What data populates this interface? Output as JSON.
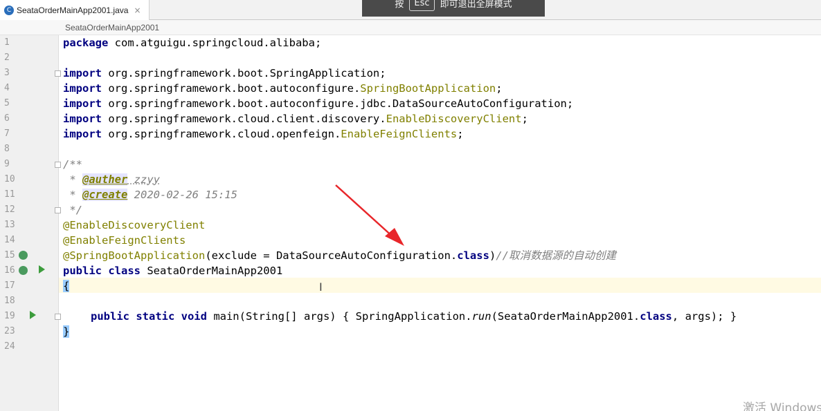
{
  "tab": {
    "filename": "SeataOrderMainApp2001.java",
    "close": "×",
    "icon": "C"
  },
  "overlay": {
    "before": "按",
    "key": "Esc",
    "after": "即可退出全屏模式"
  },
  "breadcrumb": "SeataOrderMainApp2001",
  "line_numbers": [
    "1",
    "2",
    "3",
    "4",
    "5",
    "6",
    "7",
    "8",
    "9",
    "10",
    "11",
    "12",
    "13",
    "14",
    "15",
    "16",
    "17",
    "18",
    "19",
    "23",
    "24"
  ],
  "code": {
    "l1_kw": "package",
    "l1_rest": " com.atguigu.springcloud.alibaba;",
    "imp": "import",
    "l3": " org.springframework.boot.SpringApplication;",
    "l4_a": " org.springframework.boot.autoconfigure.",
    "l4_b": "SpringBootApplication",
    "l4_c": ";",
    "l5": " org.springframework.boot.autoconfigure.jdbc.DataSourceAutoConfiguration;",
    "l6_a": " org.springframework.cloud.client.discovery.",
    "l6_b": "EnableDiscoveryClient",
    "l6_c": ";",
    "l7_a": " org.springframework.cloud.openfeign.",
    "l7_b": "EnableFeignClients",
    "l7_c": ";",
    "l9": "/**",
    "l10_star": " * ",
    "l10_tag": "@auther",
    "l10_val": " zzyy",
    "l11_star": " * ",
    "l11_tag": "@create",
    "l11_val": " 2020-02-26 15:15",
    "l12": " */",
    "l13": "@EnableDiscoveryClient",
    "l14": "@EnableFeignClients",
    "l15_ann": "@SpringBootApplication",
    "l15_a": "(exclude = DataSourceAutoConfiguration.",
    "l15_kw": "class",
    "l15_b": ")",
    "l15_cmt": "//取消数据源的自动创建",
    "l16_kw": "public class",
    "l16_rest": " SeataOrderMainApp2001",
    "l17": "{",
    "l19_kw": "public static void",
    "l19_a": " main(String[] args) { SpringApplication.",
    "l19_fn": "run",
    "l19_b": "(SeataOrderMainApp2001.",
    "l19_kw2": "class",
    "l19_c": ", args); }",
    "l23": "}"
  },
  "watermark": "激活 Windows"
}
